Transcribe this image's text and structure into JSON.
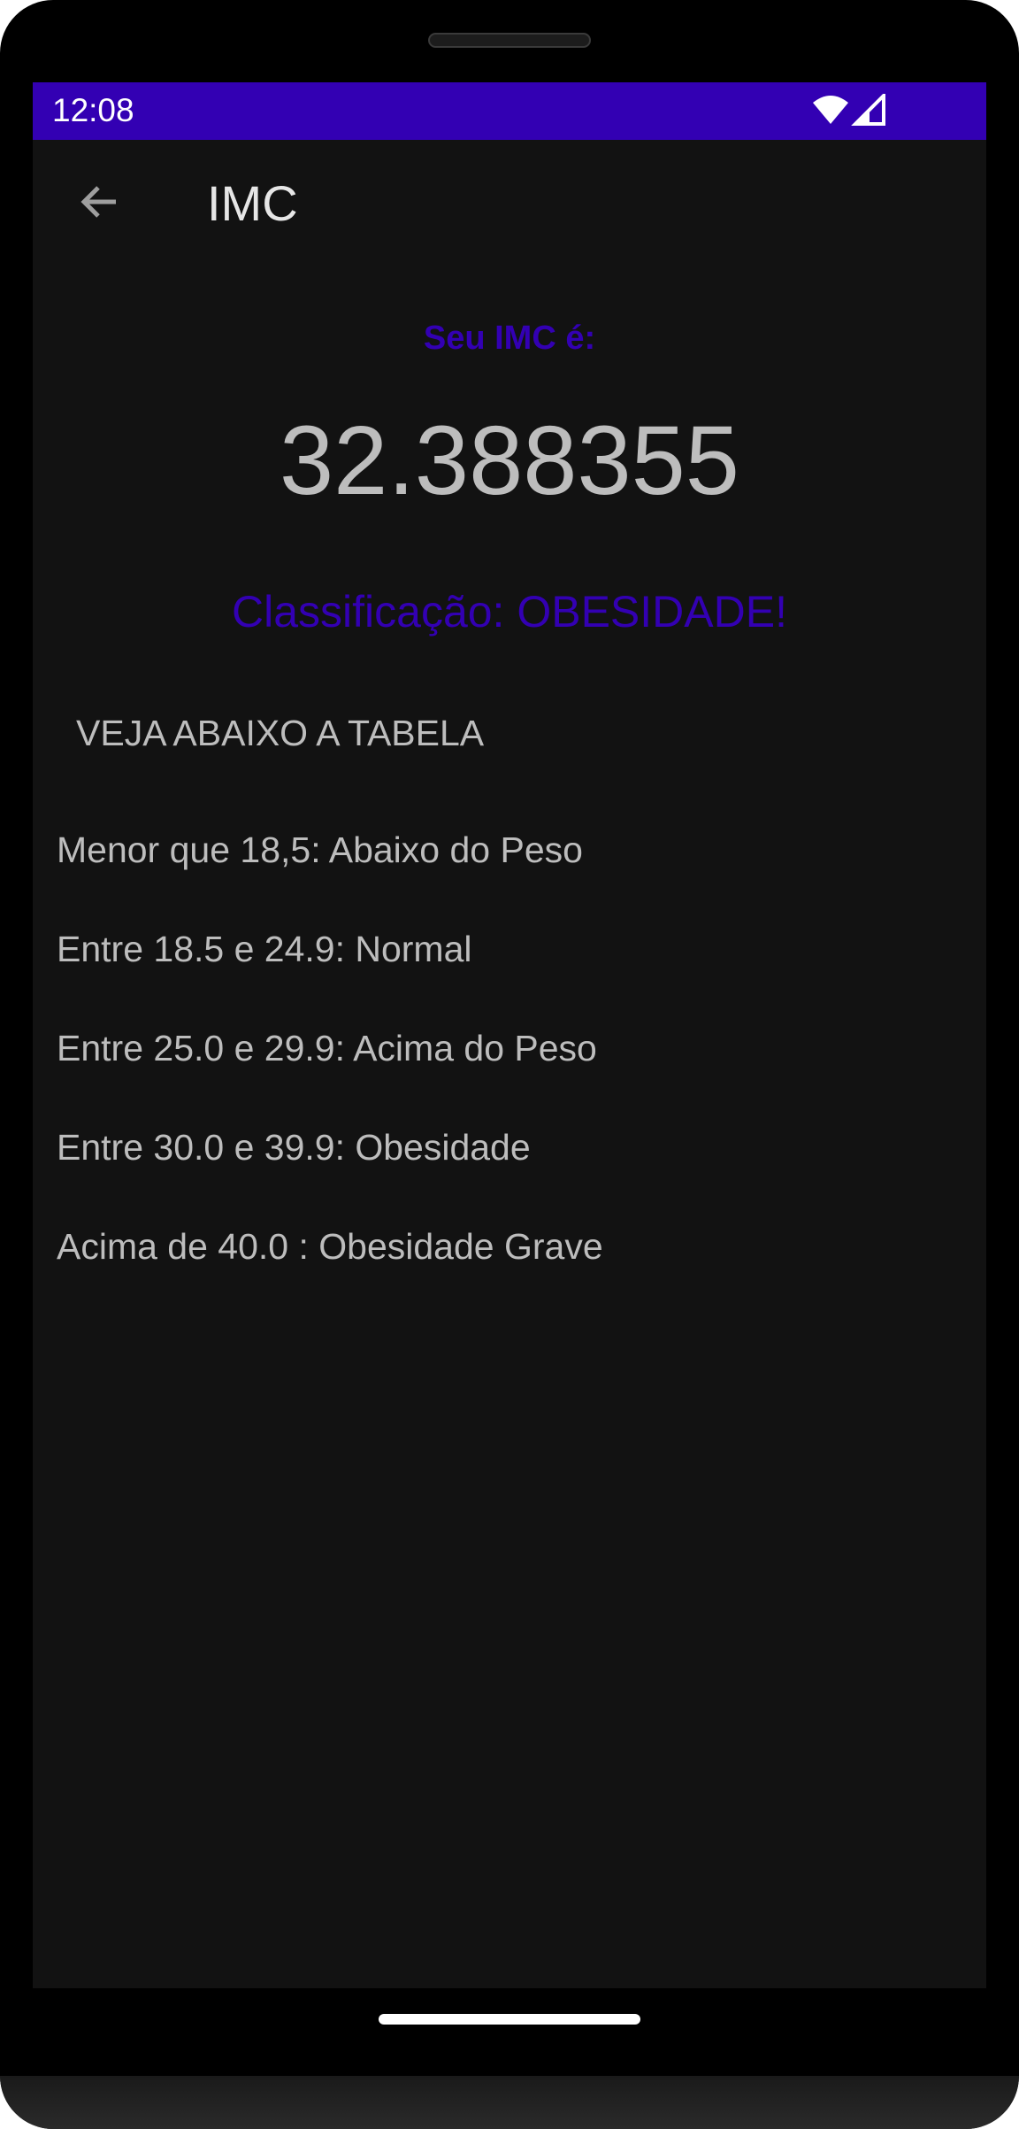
{
  "status_bar": {
    "time": "12:08",
    "icons": [
      "wifi-icon",
      "cellular-signal-icon"
    ],
    "color": "#3300b3"
  },
  "app_bar": {
    "title": "IMC",
    "back_icon": "arrow-back-icon"
  },
  "result": {
    "label": "Seu IMC é:",
    "value": "32.388355",
    "classification": "Classificação: OBESIDADE!",
    "accent_color": "#3300b3"
  },
  "table": {
    "heading": "VEJA ABAIXO A TABELA",
    "rows": [
      "Menor que 18,5: Abaixo do Peso",
      "Entre 18.5 e 24.9: Normal",
      "Entre 25.0 e 29.9: Acima do Peso",
      "Entre 30.0 e 39.9: Obesidade",
      "Acima de 40.0 : Obesidade Grave"
    ]
  },
  "colors": {
    "background": "#121212",
    "text": "#bdbdbd",
    "status_bar": "#3300b3"
  }
}
